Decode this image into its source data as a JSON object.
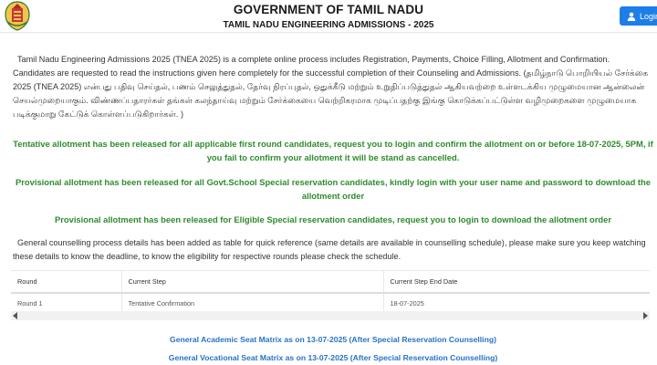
{
  "header": {
    "title": "GOVERNMENT OF TAMIL NADU",
    "subtitle": "TAMIL NADU ENGINEERING ADMISSIONS - 2025",
    "login_label": "Login"
  },
  "intro": "Tamil Nadu Engineering Admissions 2025 (TNEA 2025) is a complete online process includes Registration, Payments, Choice Filling, Allotment and Confirmation. Candidates are requested to read the instructions given here completely for the successful completion of their Counseling and Admissions. (தமிழ்நாடு பொறியியல் சேர்க்கை 2025 (TNEA 2025) என்பது பதிவு செய்தல், பணம் செலுத்துதல், தேர்வு நிரப்புதல், ஒதுக்கீடு மற்றும் உறுதிப்படுத்துதல் ஆகியவற்றை உள்ளடக்கிய முழுமையான ஆன்லைன் செயல்முறையாகும். விண்ணப்பதாரர்கள் தங்கள் கலந்தாய்வு மற்றும் சேர்க்கையை வெற்றிகரமாக முடிப்பதற்கு இங்கு கொடுக்கப்பட்டுள்ள வழிமுறைகளை முழுமையாக படிக்குமாறு கேட்டுக் கொள்ளப்படுகிறார்கள். )",
  "notices": [
    "Tentative allotment has been released for all applicable first round candidates, request you to login and confirm the allotment on or before 18-07-2025, 5PM, if you fail to confirm your allotment it will be stand as cancelled.",
    "Provisional allotment has been released for all Govt.School Special reservation candidates, kindly login with your user name and password to download the allotment order",
    "Provisional allotment has been released for Eligible Special reservation candidates, request you to login to download the allotment order"
  ],
  "general_text": "General counselling process details has been added as table for quick reference (same details are available in counselling schedule), please make sure you keep watching these details to know the deadline, to know the eligibility for respective rounds please check the schedule.",
  "table": {
    "headers": [
      "Round",
      "Current Step",
      "Current Step End Date"
    ],
    "rows": [
      [
        "Round 1",
        "Tentative Confirmation",
        "18-07-2025"
      ]
    ]
  },
  "links": [
    "General Academic Seat Matrix as on 13-07-2025 (After Special Reservation Counselling)",
    "General Vocational Seat Matrix as on 13-07-2025 (After Special Reservation Counselling)"
  ],
  "colors": {
    "notice_green": "#2e8b2e",
    "link_blue": "#2773c4",
    "login_blue": "#1e7ee8"
  },
  "icons": [
    "tamil-nadu-emblem-icon",
    "user-icon",
    "scroll-left-icon",
    "scroll-right-icon"
  ]
}
